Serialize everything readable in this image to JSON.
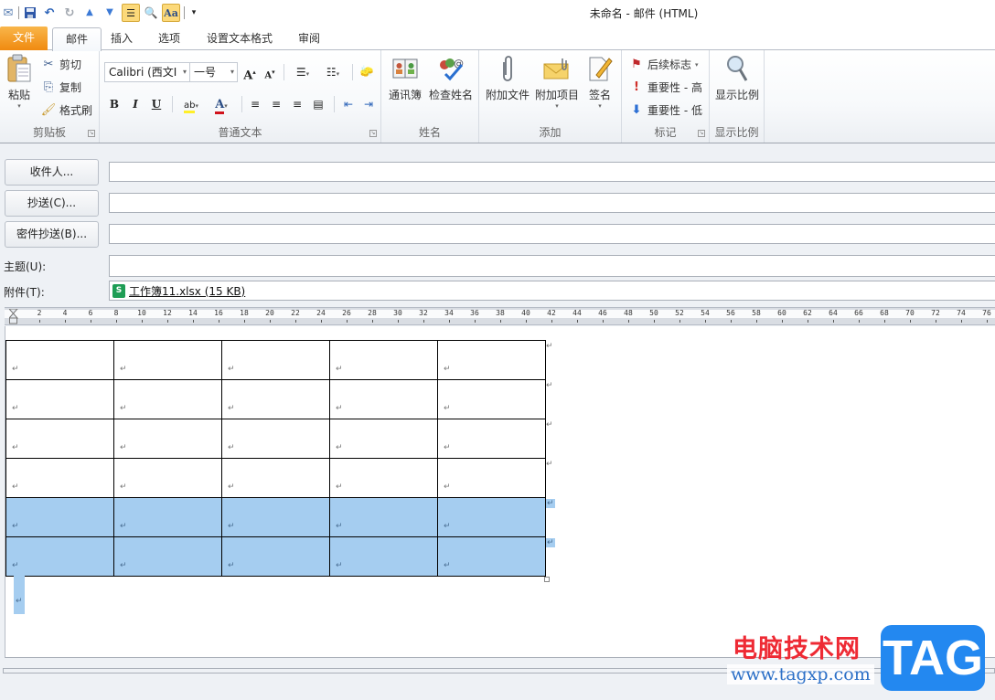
{
  "window": {
    "title": "未命名  -  邮件 (HTML)"
  },
  "quick_access": [
    {
      "name": "send-receive-icon",
      "glyph": "✉"
    },
    {
      "name": "save-icon",
      "glyph": "💾"
    },
    {
      "name": "undo-icon",
      "glyph": "↶"
    },
    {
      "name": "redo-icon",
      "glyph": "↻"
    },
    {
      "name": "previous-item-icon",
      "glyph": "▲"
    },
    {
      "name": "next-item-icon",
      "glyph": "▼"
    },
    {
      "name": "outline-view-icon",
      "glyph": "☰"
    },
    {
      "name": "print-preview-icon",
      "glyph": "🔍"
    },
    {
      "name": "styles-icon",
      "glyph": "Aa"
    },
    {
      "name": "customize-qat-icon",
      "glyph": "▾"
    }
  ],
  "tabs": [
    {
      "label": "文件",
      "active": false
    },
    {
      "label": "邮件",
      "active": true
    },
    {
      "label": "插入",
      "active": false
    },
    {
      "label": "选项",
      "active": false
    },
    {
      "label": "设置文本格式",
      "active": false
    },
    {
      "label": "审阅",
      "active": false
    }
  ],
  "ribbon": {
    "clipboard": {
      "label": "剪贴板",
      "paste": "粘贴",
      "cut": "剪切",
      "copy": "复制",
      "format_painter": "格式刷"
    },
    "basic_text": {
      "label": "普通文本",
      "font_name": "Calibri (西文I",
      "font_size": "一号",
      "grow_font": "A",
      "shrink_font": "A",
      "bold": "B",
      "italic": "I",
      "underline": "U",
      "highlight": "ab",
      "font_color": "A"
    },
    "names": {
      "label": "姓名",
      "address_book": "通讯簿",
      "check_names": "检查姓名"
    },
    "include": {
      "label": "添加",
      "attach_file": "附加文件",
      "attach_item": "附加项目",
      "signature": "签名"
    },
    "tags": {
      "label": "标记",
      "follow_up": "后续标志",
      "high_importance": "重要性 - 高",
      "low_importance": "重要性 - 低"
    },
    "zoom": {
      "label": "显示比例",
      "zoom": "显示比例"
    }
  },
  "header": {
    "to_button": "收件人...",
    "cc_button": "抄送(C)...",
    "bcc_button": "密件抄送(B)...",
    "subject_label": "主题(U):",
    "attachment_label": "附件(T):",
    "to_value": "",
    "cc_value": "",
    "bcc_value": "",
    "subject_value": "",
    "attachment": "工作簿11.xlsx (15 KB)"
  },
  "ruler": {
    "labels": [
      "2",
      "4",
      "6",
      "8",
      "10",
      "12",
      "14",
      "16",
      "18",
      "20",
      "22",
      "24",
      "26",
      "28",
      "30",
      "32",
      "34",
      "36",
      "38",
      "40",
      "42",
      "44",
      "46",
      "48",
      "50",
      "52",
      "54",
      "56",
      "58",
      "60",
      "62",
      "64",
      "66",
      "68",
      "70",
      "72",
      "74",
      "76"
    ]
  },
  "document": {
    "table": {
      "rows": 6,
      "cols": 5,
      "selected_rows": [
        4,
        5
      ],
      "cell_mark": "↵"
    },
    "paragraph_mark": "↵"
  },
  "watermark": {
    "cn_text": "电脑技术网",
    "url": "www.tagxp.com",
    "tag": "TAG"
  }
}
